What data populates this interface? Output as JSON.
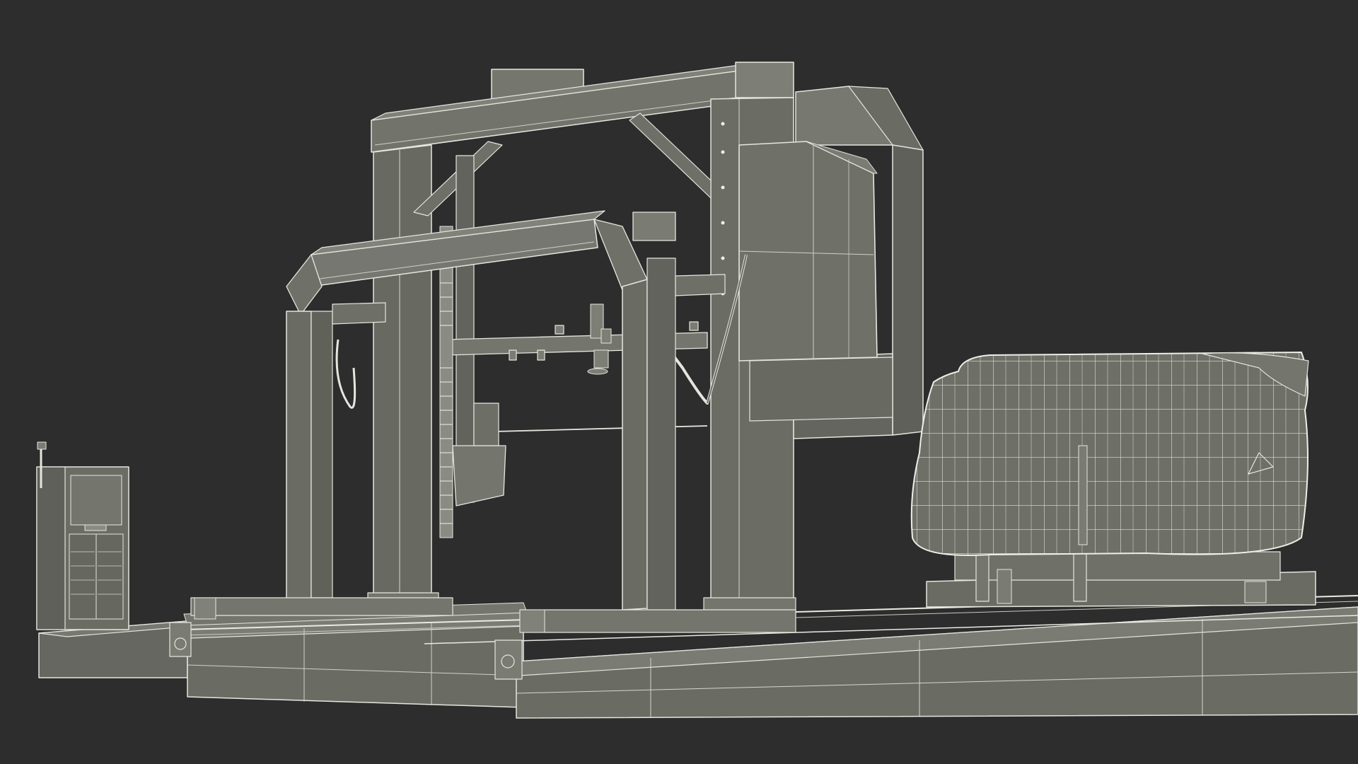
{
  "scene": {
    "subject": "wireframe-band-sawmill-render",
    "colors": {
      "background": "#2d2d2d",
      "surface": "#6d6e66",
      "surface_light": "#7a7b72",
      "surface_dark": "#5b5c55",
      "wire": "#e6e6e0",
      "wire_soft": "#c9c9c1"
    },
    "parts": [
      "rail-bed",
      "track-rails",
      "control-cabinet",
      "rear-gantry-frame",
      "front-gantry-frame",
      "saw-head-housing",
      "blade-guide-arm",
      "cutting-blade",
      "chain-conveyor",
      "log",
      "log-cradle"
    ]
  }
}
